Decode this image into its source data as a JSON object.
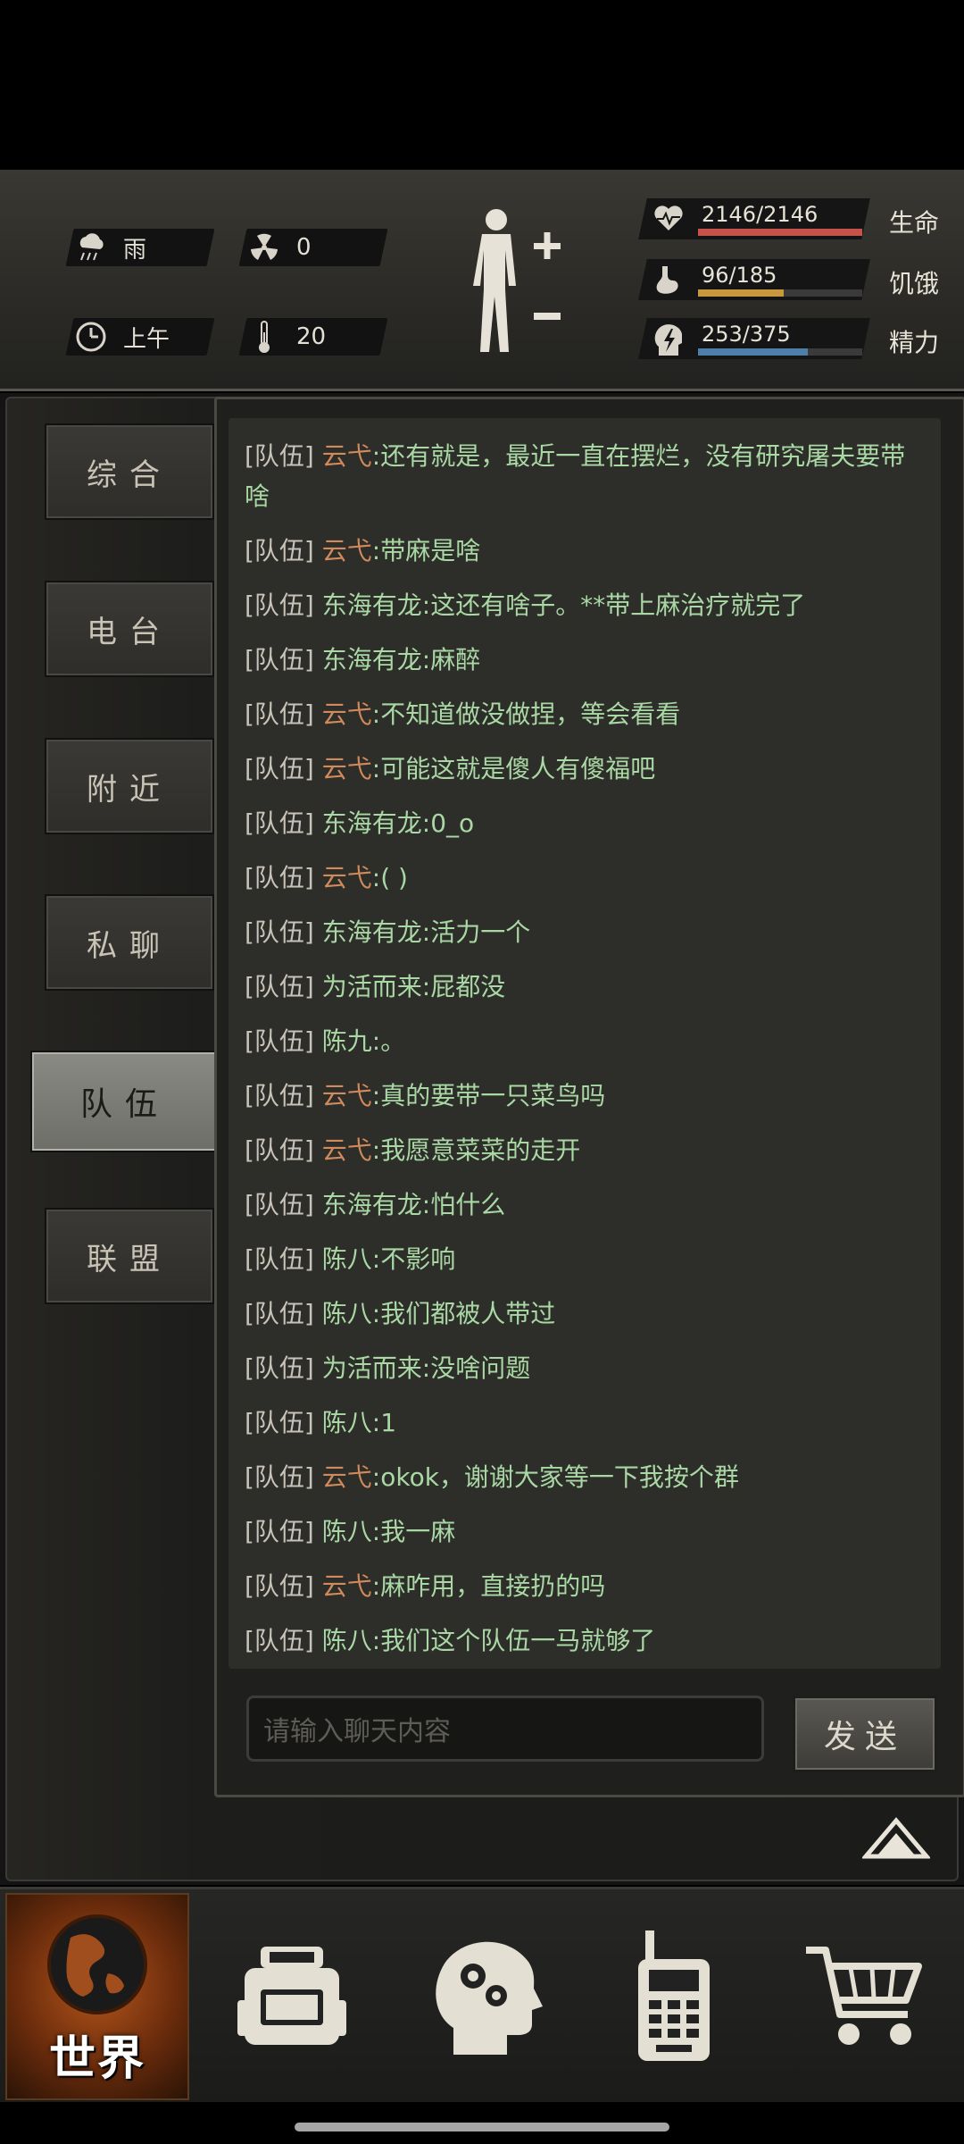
{
  "status": {
    "weather": "雨",
    "radiation": "0",
    "time_of_day": "上午",
    "temperature": "20",
    "health": {
      "value": "2146/2146",
      "label": "生命",
      "fraction": 1.0,
      "color": "#c7524a"
    },
    "hunger": {
      "value": "96/185",
      "label": "饥饿",
      "fraction": 0.52,
      "color": "#c9973e"
    },
    "energy": {
      "value": "253/375",
      "label": "精力",
      "fraction": 0.67,
      "color": "#4e7fa8"
    }
  },
  "tabs": [
    {
      "label": "综合"
    },
    {
      "label": "电台"
    },
    {
      "label": "附近"
    },
    {
      "label": "私聊"
    },
    {
      "label": "队伍",
      "active": true
    },
    {
      "label": "联盟"
    }
  ],
  "chat": {
    "messages": [
      {
        "channel": "[队伍]",
        "name": "云弋",
        "text": ":还有就是，最近一直在摆烂，没有研究屠夫要带啥"
      },
      {
        "channel": "[队伍]",
        "name": "云弋",
        "text": ":带麻是啥"
      },
      {
        "channel": "[队伍]",
        "name": "东海有龙",
        "text": ":这还有啥子。**带上麻治疗就完了"
      },
      {
        "channel": "[队伍]",
        "name": "东海有龙",
        "text": ":麻醉"
      },
      {
        "channel": "[队伍]",
        "name": "云弋",
        "text": ":不知道做没做捏，等会看看"
      },
      {
        "channel": "[队伍]",
        "name": "云弋",
        "text": ":可能这就是傻人有傻福吧"
      },
      {
        "channel": "[队伍]",
        "name": "东海有龙",
        "text": ":0_o"
      },
      {
        "channel": "[队伍]",
        "name": "云弋",
        "text": ":(                         )"
      },
      {
        "channel": "[队伍]",
        "name": "东海有龙",
        "text": ":活力一个"
      },
      {
        "channel": "[队伍]",
        "name": "为活而来",
        "text": ":屁都没"
      },
      {
        "channel": "[队伍]",
        "name": "陈九",
        "text": ":。"
      },
      {
        "channel": "[队伍]",
        "name": "云弋",
        "text": ":真的要带一只菜鸟吗"
      },
      {
        "channel": "[队伍]",
        "name": "云弋",
        "text": ":我愿意菜菜的走开"
      },
      {
        "channel": "[队伍]",
        "name": "东海有龙",
        "text": ":怕什么"
      },
      {
        "channel": "[队伍]",
        "name": "陈八",
        "text": ":不影响"
      },
      {
        "channel": "[队伍]",
        "name": "陈八",
        "text": ":我们都被人带过"
      },
      {
        "channel": "[队伍]",
        "name": "为活而来",
        "text": ":没啥问题"
      },
      {
        "channel": "[队伍]",
        "name": "陈八",
        "text": ":1"
      },
      {
        "channel": "[队伍]",
        "name": "云弋",
        "text": ":okok，谢谢大家等一下我按个群"
      },
      {
        "channel": "[队伍]",
        "name": "陈八",
        "text": ":我一麻"
      },
      {
        "channel": "[队伍]",
        "name": "云弋",
        "text": ":麻咋用，直接扔的吗"
      },
      {
        "channel": "[队伍]",
        "name": "陈八",
        "text": ":我们这个队伍一马就够了"
      }
    ],
    "highlight_name": "云弋",
    "highlight_color": "#d08a5c",
    "input_placeholder": "请输入聊天内容",
    "send_label": "发送"
  },
  "nav": {
    "world_label": "世界",
    "items": [
      "backpack-icon",
      "skills-head-icon",
      "radio-icon",
      "shop-cart-icon"
    ]
  }
}
